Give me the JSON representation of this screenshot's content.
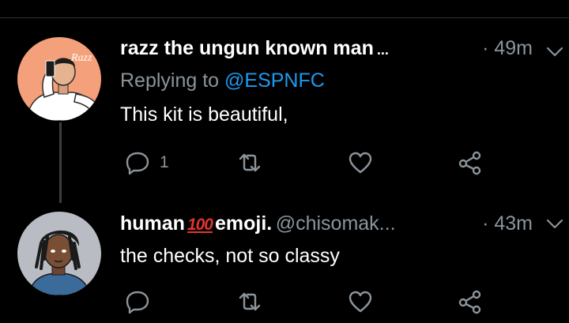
{
  "tweets": [
    {
      "display_name": "razz the ungun known man",
      "name_truncation": "...",
      "separator": "·",
      "timestamp": "49m",
      "replying_prefix": "Replying to",
      "replying_mention": "@ESPNFC",
      "text": "This kit is beautiful,",
      "reply_count": "1",
      "avatar_badge_text": "Razz",
      "colors": {
        "avatar_bg": "#f4a07a"
      }
    },
    {
      "display_name_prefix": "human",
      "display_name_emoji": "100",
      "display_name_suffix": "emoji.",
      "handle": "@chisomak...",
      "separator": "·",
      "timestamp": "43m",
      "text": "the checks, not so classy",
      "reply_count": "",
      "colors": {
        "avatar_bg": "#b9bcc2"
      }
    }
  ],
  "icons": {
    "reply": "speech-bubble-icon",
    "retweet": "retweet-arrows-icon",
    "like": "heart-outline-icon",
    "share": "share-nodes-icon",
    "more": "chevron-down-icon"
  },
  "colors": {
    "background": "#000000",
    "text_primary": "#ffffff",
    "text_secondary": "#8b949b",
    "link": "#1d9bf0",
    "divider": "#2f3336"
  }
}
